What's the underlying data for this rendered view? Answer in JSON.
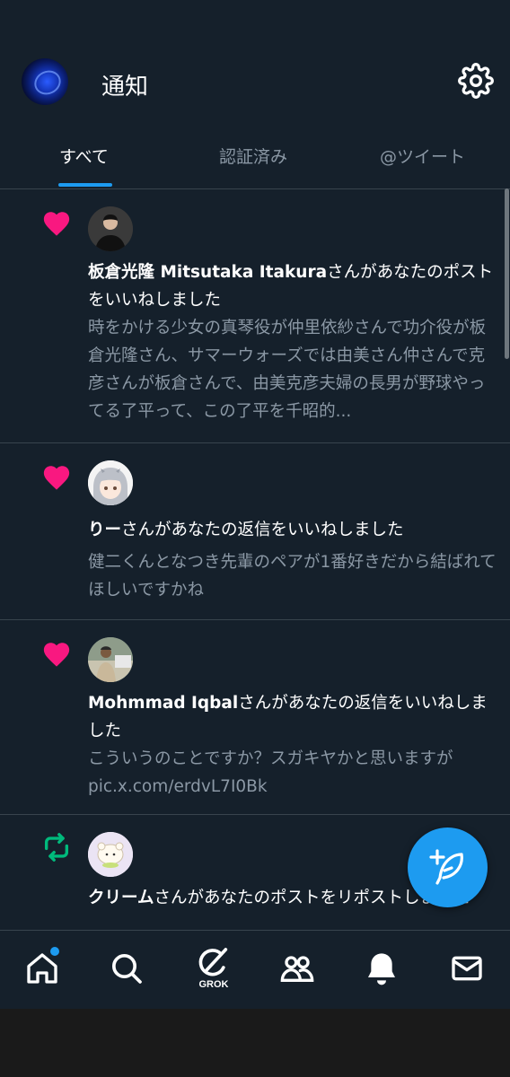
{
  "header": {
    "title": "通知"
  },
  "tabs": [
    {
      "label": "すべて",
      "active": true
    },
    {
      "label": "認証済み",
      "active": false
    },
    {
      "label": "@ツイート",
      "active": false
    }
  ],
  "notifications": [
    {
      "type": "like",
      "user": "板倉光隆 Mitsutaka Itakura",
      "action": "さんがあなたのポストをいいねしました",
      "body": "時をかける少女の真琴役が仲里依紗さんで功介役が板倉光隆さん、サマーウォーズでは由美さん仲さんで克彦さんが板倉さんで、由美克彦夫婦の長男が野球やってる了平って、この了平を千昭的..."
    },
    {
      "type": "like",
      "user": "りー",
      "action": "さんがあなたの返信をいいねしました",
      "body": "健二くんとなつき先輩のペアが1番好きだから結ばれてほしいですかね"
    },
    {
      "type": "like",
      "user": "Mohmmad Iqbal",
      "action": "さんがあなたの返信をいいねしました",
      "body": "こういうのことですか？スガキヤかと思いますが pic.x.com/erdvL7I0Bk"
    },
    {
      "type": "repost",
      "user": "クリーム",
      "action": "さんがあなたのポストをリポストしました",
      "body": ""
    }
  ],
  "bottom_nav": {
    "grok_label": "GROK",
    "has_home_badge": true
  },
  "colors": {
    "background": "#15202b",
    "accent": "#1d9bf0",
    "like": "#f91880",
    "repost": "#00ba7c",
    "secondary_text": "#8b98a5"
  }
}
